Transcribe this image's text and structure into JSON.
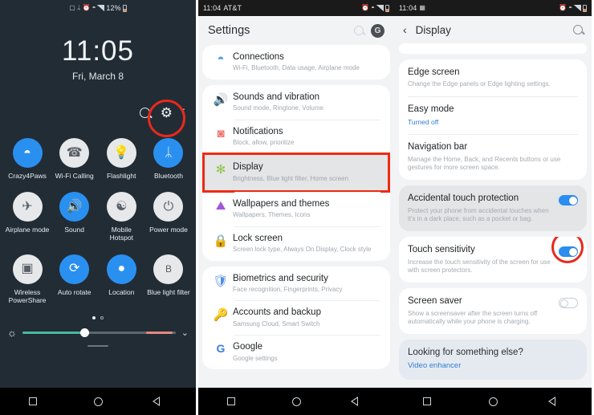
{
  "panel1": {
    "statusbar": {
      "icons": [
        "nfc-icon",
        "bluetooth-icon",
        "alarm-icon",
        "wifi-icon",
        "signal-icon"
      ],
      "battery_percent": "12%"
    },
    "clock": "11:05",
    "date": "Fri, March 8",
    "header_icons": {
      "search": "search-icon",
      "settings": "gear-icon",
      "more": "more-options-icon"
    },
    "tiles": [
      {
        "label": "Crazy4Paws",
        "glyph": "◓",
        "icon": "wifi-icon",
        "state": "on"
      },
      {
        "label": "Wi-Fi Calling",
        "glyph": "✆",
        "icon": "wifi-calling-icon",
        "state": "off"
      },
      {
        "label": "Flashlight",
        "glyph": "┴",
        "icon": "flashlight-icon",
        "state": "off"
      },
      {
        "label": "Bluetooth",
        "glyph": "ᛦ",
        "icon": "bluetooth-icon",
        "state": "on"
      },
      {
        "label": "Airplane mode",
        "glyph": "✈",
        "icon": "airplane-icon",
        "state": "off"
      },
      {
        "label": "Sound",
        "glyph": "🔊",
        "icon": "sound-icon",
        "state": "on"
      },
      {
        "label": "Mobile Hotspot",
        "glyph": "⏺",
        "icon": "hotspot-icon",
        "state": "off"
      },
      {
        "label": "Power mode",
        "glyph": "⚡",
        "icon": "power-mode-icon",
        "state": "off"
      },
      {
        "label": "Wireless PowerShare",
        "glyph": "▣",
        "icon": "powershare-icon",
        "state": "off"
      },
      {
        "label": "Auto rotate",
        "glyph": "⟳",
        "icon": "auto-rotate-icon",
        "state": "on"
      },
      {
        "label": "Location",
        "glyph": "◉",
        "icon": "location-icon",
        "state": "on"
      },
      {
        "label": "Blue light filter",
        "glyph": "Β",
        "icon": "blue-light-filter-icon",
        "state": "off"
      }
    ],
    "brightness": {
      "icon": "brightness-icon",
      "expand": "⌄"
    },
    "colors": {
      "accent_on": "#2a90f0",
      "slider_fill": "#49b79c",
      "slider_end": "#e28a80",
      "annotation": "#e8291c"
    }
  },
  "panel2": {
    "statusbar": {
      "time": "11:04",
      "carrier": "AT&T"
    },
    "title": "Settings",
    "avatar_letter": "G",
    "groups": [
      {
        "items": [
          {
            "title": "Connections",
            "sub": "Wi-Fi, Bluetooth, Data usage, Airplane mode",
            "icon": "wifi-icon",
            "glyph": "◓",
            "color": "#4f9ee8"
          }
        ]
      },
      {
        "items": [
          {
            "title": "Sounds and vibration",
            "sub": "Sound mode, Ringtone, Volume",
            "icon": "sound-icon",
            "glyph": "🔊",
            "color": "#7a6bd8"
          },
          {
            "title": "Notifications",
            "sub": "Block, allow, prioritize",
            "icon": "notifications-icon",
            "glyph": "◗",
            "color": "#f0716b"
          },
          {
            "title": "Display",
            "sub": "Brightness, Blue light filter, Home screen",
            "icon": "display-icon",
            "glyph": "✻",
            "color": "#8dc63f",
            "highlighted": true
          },
          {
            "title": "Wallpapers and themes",
            "sub": "Wallpapers, Themes, Icons",
            "icon": "wallpaper-icon",
            "glyph": "✃",
            "color": "#a057d6"
          },
          {
            "title": "Lock screen",
            "sub": "Screen lock type, Always On Display, Clock style",
            "icon": "lock-icon",
            "glyph": "⚿",
            "color": "#8d6ae0"
          }
        ]
      },
      {
        "items": [
          {
            "title": "Biometrics and security",
            "sub": "Face recognition, Fingerprints, Privacy",
            "icon": "shield-icon",
            "glyph": "⬟",
            "color": "#4f8de8"
          },
          {
            "title": "Accounts and backup",
            "sub": "Samsung Cloud, Smart Switch",
            "icon": "key-icon",
            "glyph": "⚿",
            "color": "#f0b429"
          },
          {
            "title": "Google",
            "sub": "Google settings",
            "icon": "google-icon",
            "glyph": "G",
            "color": "#3b7ddd"
          }
        ]
      }
    ]
  },
  "panel3": {
    "statusbar": {
      "time": "11:04"
    },
    "back_icon": "back-arrow-icon",
    "title": "Display",
    "search_icon": "search-icon",
    "groups": [
      {
        "type": "card",
        "items": [
          {
            "title": "Edge screen",
            "sub": "Change the Edge panels or Edge lighting settings."
          },
          {
            "title": "Easy mode",
            "sub": "Turned off",
            "sub_link": true
          },
          {
            "title": "Navigation bar",
            "sub": "Manage the Home, Back, and Recents buttons or use gestures for more screen space."
          }
        ]
      },
      {
        "type": "tint",
        "items": [
          {
            "title": "Accidental touch protection",
            "sub": "Protect your phone from accidental touches when it's in a dark place, such as a pocket or bag.",
            "toggle": "on"
          }
        ]
      },
      {
        "type": "card",
        "items": [
          {
            "title": "Touch sensitivity",
            "sub": "Increase the touch sensitivity of the screen for use with screen protectors.",
            "toggle": "on",
            "annotated": true
          }
        ]
      },
      {
        "type": "card",
        "items": [
          {
            "title": "Screen saver",
            "sub": "Show a screensaver after the screen turns off automatically while your phone is charging.",
            "toggle": "off"
          }
        ]
      }
    ],
    "info": {
      "heading": "Looking for something else?",
      "link": "Video enhancer"
    },
    "colors": {
      "toggle_on": "#2a8df0",
      "link": "#2f7fd4",
      "annotation": "#e8291c"
    }
  }
}
